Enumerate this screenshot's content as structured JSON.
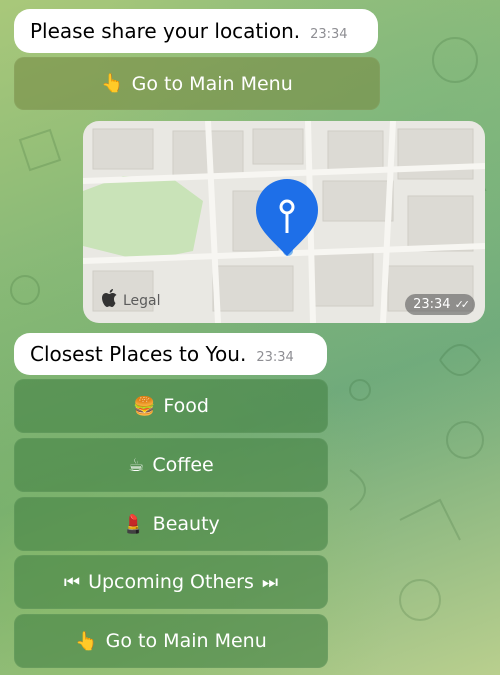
{
  "messages": {
    "location_request": {
      "text": "Please share your location.",
      "time": "23:34"
    },
    "closest_places": {
      "text": "Closest Places to You.",
      "time": "23:34"
    }
  },
  "keyboard_top": {
    "main_menu": {
      "emoji": "👆",
      "label": "Go to Main Menu"
    }
  },
  "map": {
    "time": "23:34",
    "status_icon": "double-check-icon",
    "legal": "Legal"
  },
  "keyboard": {
    "food": {
      "emoji": "🍔",
      "label": "Food"
    },
    "coffee": {
      "emoji": "☕",
      "label": "Coffee"
    },
    "beauty": {
      "emoji": "💄",
      "label": "Beauty"
    },
    "upcoming": {
      "emoji_before": "⏮",
      "label": "Upcoming Others",
      "emoji_after": "⏭"
    },
    "main_menu": {
      "emoji": "👆",
      "label": "Go to Main Menu"
    }
  },
  "colors": {
    "bubble": "#ffffff",
    "button": "#4f8a4f",
    "pin": "#1e6fe8"
  }
}
